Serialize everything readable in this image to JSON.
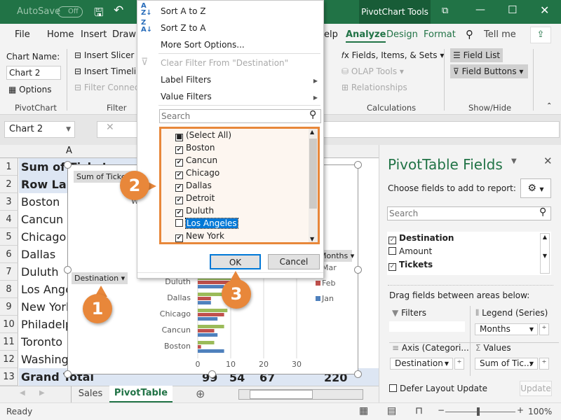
{
  "titlebar": {
    "autosave": "AutoSave",
    "autosave_state": "Off",
    "context_tab": "PivotChart Tools"
  },
  "tabs": [
    "File",
    "Home",
    "Insert",
    "Draw",
    "elp",
    "Analyze",
    "Design",
    "Format",
    "Tell me"
  ],
  "active_tab": "Analyze",
  "ribbon": {
    "chart_name_label": "Chart Name:",
    "chart_name_value": "Chart 2",
    "options": "Options",
    "group_pivotchart": "PivotChart",
    "insert_slicer": "Insert Slicer",
    "insert_timeline": "Insert Timeline",
    "filter_connections": "Filter Connections",
    "group_filter": "Filter",
    "fields_items_sets": "Fields, Items, & Sets",
    "olap_tools": "OLAP Tools",
    "relationships": "Relationships",
    "group_calculations": "Calculations",
    "field_list": "Field List",
    "field_buttons": "Field Buttons",
    "group_showhide": "Show/Hide"
  },
  "namebox": "Chart 2",
  "grid": {
    "column": "A",
    "rows": [
      "1",
      "2",
      "3",
      "4",
      "5",
      "6",
      "7",
      "8",
      "9",
      "10",
      "11",
      "12",
      "13"
    ],
    "cells": [
      "Sum of Tickets",
      "Row Labels",
      "Boston",
      "Cancun",
      "Chicago",
      "Dallas",
      "Duluth",
      "Los Angeles",
      "New York",
      "Philadelphia",
      "Toronto",
      "Washington",
      "Grand Total"
    ],
    "totals": [
      "99",
      "54",
      "67",
      "220"
    ]
  },
  "chart": {
    "values_button": "Sum of Tickets",
    "axis_button": "Destination",
    "legend_button": "Months",
    "title_fragment": "W",
    "chart_data": {
      "type": "bar",
      "orientation": "horizontal",
      "categories": [
        "Boston",
        "Cancun",
        "Chicago",
        "Dallas",
        "Duluth"
      ],
      "series": [
        {
          "name": "Jan",
          "color": "#4f81bd",
          "values": [
            8,
            6,
            6,
            4,
            8
          ]
        },
        {
          "name": "Feb",
          "color": "#c0504d",
          "values": [
            1,
            5,
            8,
            4,
            12
          ]
        },
        {
          "name": "Mar",
          "color": "#9bbb59",
          "values": [
            5,
            8,
            9,
            8,
            10
          ]
        }
      ],
      "xticks": [
        "0",
        "10",
        "20",
        "30"
      ],
      "xlim": [
        0,
        35
      ],
      "legend": [
        "Mar",
        "Feb",
        "Jan"
      ],
      "legend_position": "right"
    }
  },
  "menu": {
    "sort_az": "Sort A to Z",
    "sort_za": "Sort Z to A",
    "more_sort": "More Sort Options...",
    "clear_filter": "Clear Filter From \"Destination\"",
    "label_filters": "Label Filters",
    "value_filters": "Value Filters",
    "search_placeholder": "Search",
    "items": [
      {
        "label": "(Select All)",
        "state": "partial"
      },
      {
        "label": "Boston",
        "state": "checked"
      },
      {
        "label": "Cancun",
        "state": "checked"
      },
      {
        "label": "Chicago",
        "state": "checked"
      },
      {
        "label": "Dallas",
        "state": "checked"
      },
      {
        "label": "Detroit",
        "state": "checked"
      },
      {
        "label": "Duluth",
        "state": "checked"
      },
      {
        "label": "Los Angeles",
        "state": "unchecked"
      },
      {
        "label": "New York",
        "state": "checked"
      }
    ],
    "ok": "OK",
    "cancel": "Cancel"
  },
  "panel": {
    "title": "PivotTable Fields",
    "choose": "Choose fields to add to report:",
    "search_placeholder": "Search",
    "fields": [
      {
        "label": "Destination",
        "checked": true
      },
      {
        "label": "Amount",
        "checked": false
      },
      {
        "label": "Tickets",
        "checked": true
      }
    ],
    "drag": "Drag fields between areas below:",
    "filters": "Filters",
    "legend": "Legend (Series)",
    "legend_value": "Months",
    "axis": "Axis (Categori...",
    "axis_value": "Destination",
    "values": "Values",
    "values_value": "Sum of Tic...",
    "defer": "Defer Layout Update",
    "update": "Update"
  },
  "sheets": [
    "Sales",
    "PivotTable"
  ],
  "active_sheet": "PivotTable",
  "status": {
    "ready": "Ready",
    "zoom": "100%"
  },
  "callouts": [
    "1",
    "2",
    "3"
  ],
  "colors": {
    "excel_green": "#217346",
    "callout_orange": "#e8873a",
    "selection_blue": "#0078d7"
  }
}
